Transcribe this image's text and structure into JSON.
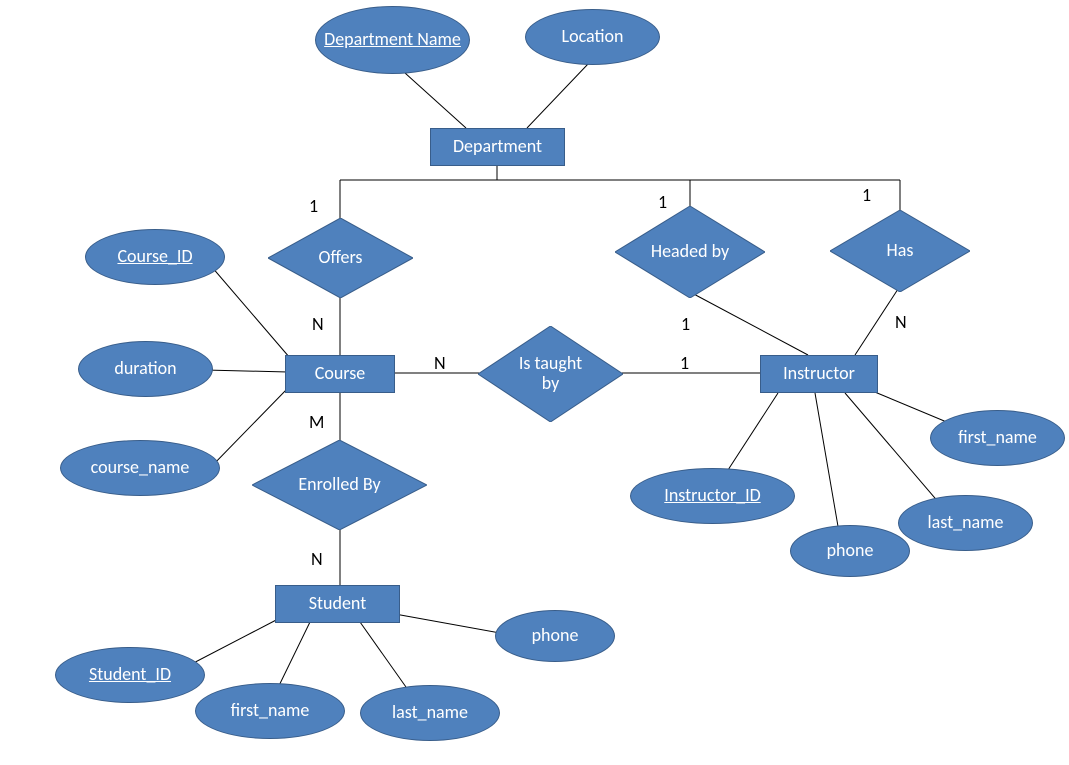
{
  "entities": {
    "department": "Department",
    "course": "Course",
    "instructor": "Instructor",
    "student": "Student"
  },
  "attributes": {
    "department_name": "Department Name",
    "location": "Location",
    "course_id": "Course_ID",
    "duration": "duration",
    "course_name": "course_name",
    "instructor_id": "Instructor_ID",
    "instr_first_name": "first_name",
    "instr_last_name": "last_name",
    "instr_phone": "phone",
    "student_id": "Student_ID",
    "stud_first_name": "first_name",
    "stud_last_name": "last_name",
    "stud_phone": "phone"
  },
  "relationships": {
    "offers": "Offers",
    "headed_by": "Headed by",
    "has": "Has",
    "is_taught_by": "Is taught by",
    "enrolled_by": "Enrolled By"
  },
  "cardinalities": {
    "offers_dept": "1",
    "offers_course": "N",
    "headed_dept": "1",
    "headed_instr": "1",
    "has_dept": "1",
    "has_instr": "N",
    "taught_course": "N",
    "taught_instr": "1",
    "enrolled_course": "M",
    "enrolled_student": "N"
  }
}
